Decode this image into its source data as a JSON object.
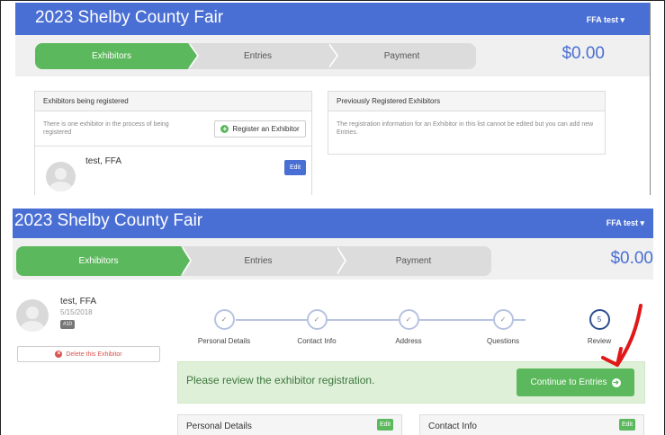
{
  "screen1": {
    "app_title": "2023 Shelby County Fair",
    "user_menu": "FFA test",
    "steps": [
      "Exhibitors",
      "Entries",
      "Payment"
    ],
    "total": "$0.00",
    "being_registered": {
      "title": "Exhibitors being registered",
      "description": "There is one exhibitor in the process of being registered",
      "register_button": "Register an Exhibitor",
      "exhibitor_name": "test, FFA",
      "edit_button": "Edit"
    },
    "previously_registered": {
      "title": "Previously Registered Exhibitors",
      "description": "The registration information for an Exhibitor in this list cannot be edited but you can add new Entries."
    }
  },
  "screen2": {
    "app_title": "2023 Shelby County Fair",
    "user_menu": "FFA test",
    "steps": [
      "Exhibitors",
      "Entries",
      "Payment"
    ],
    "total": "$0.00",
    "exhibitor": {
      "name": "test, FFA",
      "date": "5/15/2018",
      "badge": "#10",
      "delete_button": "Delete this Exhibitor"
    },
    "wizard_steps": [
      {
        "label": "Personal Details",
        "mark": "✓"
      },
      {
        "label": "Contact Info",
        "mark": "✓"
      },
      {
        "label": "Address",
        "mark": "✓"
      },
      {
        "label": "Questions",
        "mark": "✓"
      },
      {
        "label": "Review",
        "mark": "5"
      }
    ],
    "review_message": "Please review the exhibitor registration.",
    "continue_button": "Continue to Entries",
    "sections": [
      {
        "title": "Personal Details",
        "edit": "Edit"
      },
      {
        "title": "Contact Info",
        "edit": "Edit"
      }
    ]
  },
  "colors": {
    "navbar": "#4a6fd4",
    "success": "#5cb85c",
    "annotation_arrow": "#e01818"
  }
}
